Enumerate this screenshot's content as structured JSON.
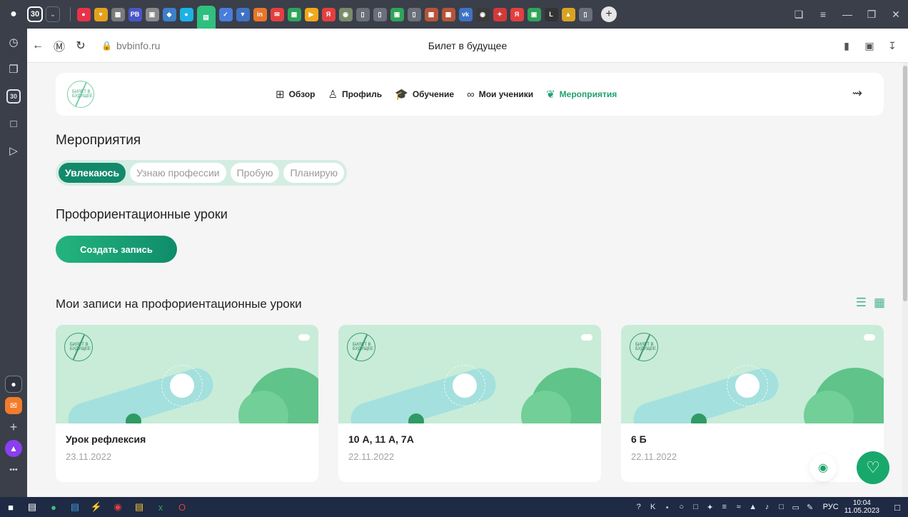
{
  "browser": {
    "tab_count": "30",
    "new_tab_glyph": "+",
    "tabs": [
      {
        "icon": "music-icon",
        "color": "#e8324a",
        "glyph": "●"
      },
      {
        "icon": "shield-icon",
        "color": "#e4a11b",
        "glyph": "♥"
      },
      {
        "icon": "grid-icon",
        "color": "#7a7a7a",
        "glyph": "▦"
      },
      {
        "icon": "pb-icon",
        "color": "#4a56c8",
        "glyph": "PB"
      },
      {
        "icon": "qr-icon",
        "color": "#8a8a8a",
        "glyph": "▣"
      },
      {
        "icon": "diamond-icon",
        "color": "#3d7fc8",
        "glyph": "◆"
      },
      {
        "icon": "chat-icon",
        "color": "#1db2e6",
        "glyph": "●"
      },
      {
        "icon": "bvb-icon",
        "color": "#2fbf7f",
        "glyph": "▤",
        "active": true
      },
      {
        "icon": "docs-icon",
        "color": "#4a7ddb",
        "glyph": "✓"
      },
      {
        "icon": "pin-icon",
        "color": "#3f72c4",
        "glyph": "▼"
      },
      {
        "icon": "in-icon",
        "color": "#e8752a",
        "glyph": "in"
      },
      {
        "icon": "mail-icon",
        "color": "#e33f3f",
        "glyph": "✉"
      },
      {
        "icon": "apps-icon",
        "color": "#2fa45a",
        "glyph": "▦"
      },
      {
        "icon": "video-icon",
        "color": "#f2a81b",
        "glyph": "▶"
      },
      {
        "icon": "yandex-icon",
        "color": "#e33f3f",
        "glyph": "Я"
      },
      {
        "icon": "circle-icon",
        "color": "#7a8a6a",
        "glyph": "◉"
      },
      {
        "icon": "page-icon",
        "color": "#6a6f7a",
        "glyph": "▯"
      },
      {
        "icon": "page2-icon",
        "color": "#6a6f7a",
        "glyph": "▯"
      },
      {
        "icon": "image-icon",
        "color": "#2fa45a",
        "glyph": "▣"
      },
      {
        "icon": "page3-icon",
        "color": "#6a6f7a",
        "glyph": "▯"
      },
      {
        "icon": "photo-icon",
        "color": "#b5543a",
        "glyph": "▦"
      },
      {
        "icon": "photo2-icon",
        "color": "#b5543a",
        "glyph": "▦"
      },
      {
        "icon": "vk-icon",
        "color": "#3f72c4",
        "glyph": "vk"
      },
      {
        "icon": "eye-icon",
        "color": "#3a3a3a",
        "glyph": "◉"
      },
      {
        "icon": "star-icon",
        "color": "#d23a3a",
        "glyph": "✦"
      },
      {
        "icon": "yandex2-icon",
        "color": "#e33f3f",
        "glyph": "Я"
      },
      {
        "icon": "green-icon",
        "color": "#2fa45a",
        "glyph": "▣"
      },
      {
        "icon": "l-icon",
        "color": "#333333",
        "glyph": "L"
      },
      {
        "icon": "drive-icon",
        "color": "#d9a322",
        "glyph": "▲"
      },
      {
        "icon": "page4-icon",
        "color": "#6a6f7a",
        "glyph": "▯"
      }
    ],
    "url": "bvbinfo.ru",
    "page_title": "Билет в будущее"
  },
  "site": {
    "logo_text": "БИЛЕТ В БУДУЩЕЕ",
    "nav": [
      {
        "label": "Обзор",
        "icon": "grid-icon",
        "glyph": "⊞"
      },
      {
        "label": "Профиль",
        "icon": "user-icon",
        "glyph": "♙"
      },
      {
        "label": "Обучение",
        "icon": "graduation-cap-icon",
        "glyph": "🎓"
      },
      {
        "label": "Мои ученики",
        "icon": "students-icon",
        "glyph": "∞"
      },
      {
        "label": "Мероприятия",
        "icon": "handshake-icon",
        "glyph": "❦",
        "active": true
      }
    ]
  },
  "main": {
    "title": "Мероприятия",
    "chips": [
      {
        "label": "Увлекаюсь",
        "active": true
      },
      {
        "label": "Узнаю профессии"
      },
      {
        "label": "Пробую"
      },
      {
        "label": "Планирую"
      }
    ],
    "section_title": "Профориентационные уроки",
    "create_button": "Создать запись",
    "records_title": "Мои записи на профориентационные уроки",
    "cards": [
      {
        "title": "Урок рефлексия",
        "date": "23.11.2022"
      },
      {
        "title": "10 А, 11 А, 7А",
        "date": "22.11.2022"
      },
      {
        "title": "6 Б",
        "date": "22.11.2022"
      }
    ]
  },
  "taskbar": {
    "lang": "РУС",
    "time": "10:04",
    "date": "11.05.2023"
  },
  "colors": {
    "accent": "#1da26c",
    "chip_active": "#13896b",
    "card_bg": "#c8ecd8"
  }
}
